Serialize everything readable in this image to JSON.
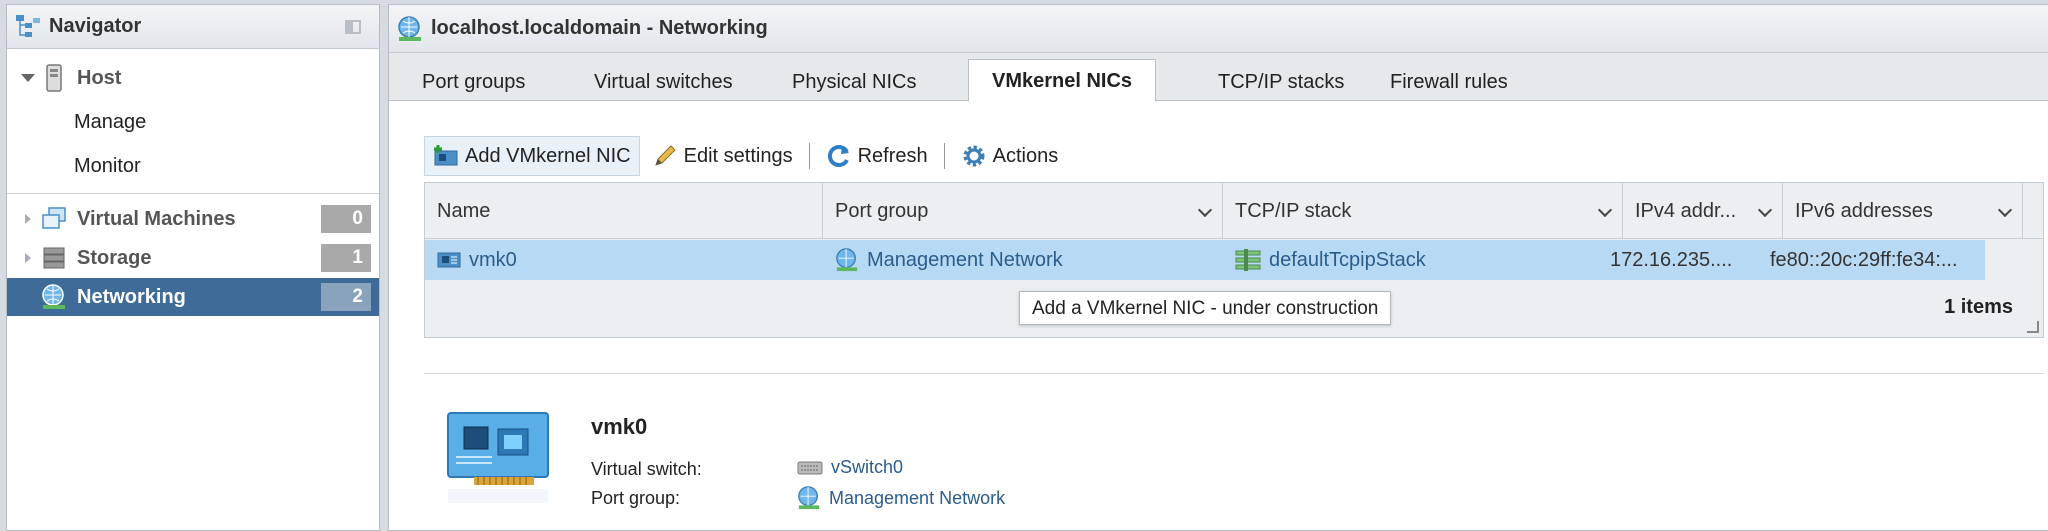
{
  "navigator": {
    "title": "Navigator",
    "host": {
      "label": "Host",
      "children": [
        "Manage",
        "Monitor"
      ]
    },
    "items": [
      {
        "label": "Virtual Machines",
        "count": "0"
      },
      {
        "label": "Storage",
        "count": "1"
      },
      {
        "label": "Networking",
        "count": "2",
        "selected": true
      }
    ]
  },
  "main": {
    "title": "localhost.localdomain - Networking",
    "tabs": [
      "Port groups",
      "Virtual switches",
      "Physical NICs",
      "VMkernel NICs",
      "TCP/IP stacks",
      "Firewall rules"
    ],
    "active_tab": "VMkernel NICs"
  },
  "toolbar": {
    "add": "Add VMkernel NIC",
    "edit": "Edit settings",
    "refresh": "Refresh",
    "actions": "Actions"
  },
  "tooltip": "Add a VMkernel NIC - under construction",
  "table": {
    "columns": [
      "Name",
      "Port group",
      "TCP/IP stack",
      "IPv4 addr...",
      "IPv6 addresses"
    ],
    "rows": [
      {
        "name": "vmk0",
        "port_group": "Management Network",
        "stack": "defaultTcpipStack",
        "ipv4": "172.16.235....",
        "ipv6": "fe80::20c:29ff:fe34:..."
      }
    ],
    "footer": "1 items"
  },
  "details": {
    "name": "vmk0",
    "fields": [
      {
        "label": "Virtual switch:",
        "value": "vSwitch0"
      },
      {
        "label": "Port group:",
        "value": "Management Network"
      }
    ]
  },
  "colors": {
    "selected_nav": "#3f6b98",
    "selected_row": "#b8d9f3",
    "link": "#2a5d8c"
  }
}
